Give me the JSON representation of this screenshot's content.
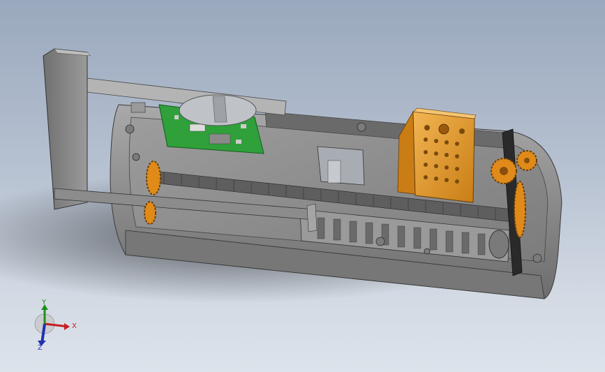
{
  "viewport": {
    "background_top": "#9aa8bd",
    "background_bottom": "#dde3eb"
  },
  "model": {
    "housing_color": "#8e8e8e",
    "pcb_color": "#2fa03a",
    "gear_color": "#e08a1a",
    "bracket_color": "#e8a53a"
  },
  "triad": {
    "x_label": "X",
    "y_label": "Y",
    "z_label": "Z",
    "x_color": "#c42020",
    "y_color": "#1e8f1e",
    "z_color": "#2030b0"
  }
}
